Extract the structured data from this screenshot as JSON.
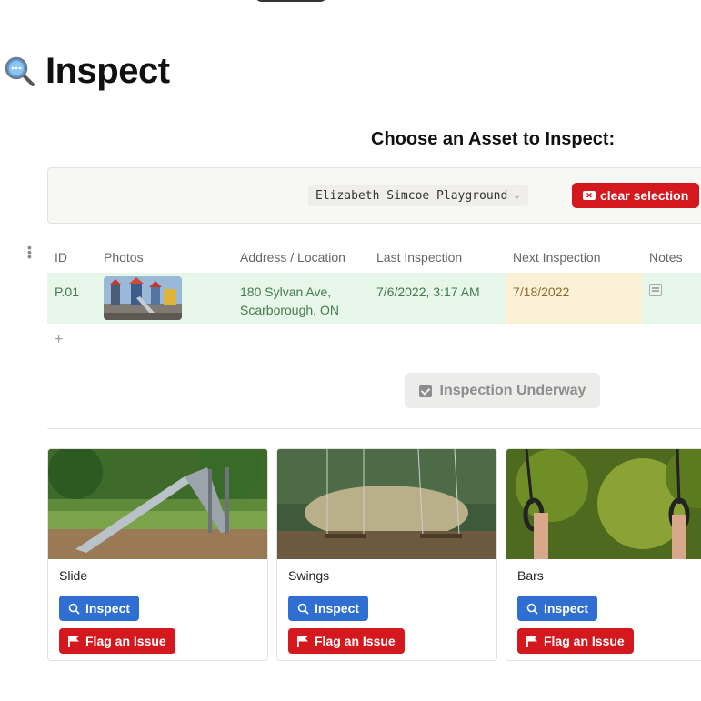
{
  "page": {
    "title": "Inspect",
    "icon": "magnifying-glass-icon"
  },
  "section": {
    "heading": "Choose an Asset to Inspect:"
  },
  "filter": {
    "selected_asset": "Elizabeth Simcoe Playground",
    "clear_label": "clear selection"
  },
  "table": {
    "headers": {
      "id": "ID",
      "photos": "Photos",
      "address": "Address / Location",
      "last": "Last Inspection",
      "next": "Next Inspection",
      "notes": "Notes"
    },
    "rows": [
      {
        "id": "P.01",
        "address": "180 Sylvan Ave, Scarborough, ON",
        "last": "7/6/2022, 3:17 AM",
        "next": "7/18/2022"
      }
    ],
    "add_row": "+"
  },
  "status": {
    "underway_label": "Inspection Underway"
  },
  "components": [
    {
      "name": "Slide",
      "inspect_label": "Inspect",
      "flag_label": "Flag an Issue"
    },
    {
      "name": "Swings",
      "inspect_label": "Inspect",
      "flag_label": "Flag an Issue"
    },
    {
      "name": "Bars",
      "inspect_label": "Inspect",
      "flag_label": "Flag an Issue"
    }
  ],
  "colors": {
    "accent_blue": "#2f6fd1",
    "danger_red": "#d4181e",
    "row_green": "#e6f6e9",
    "due_yellow": "#fbf0d6"
  }
}
